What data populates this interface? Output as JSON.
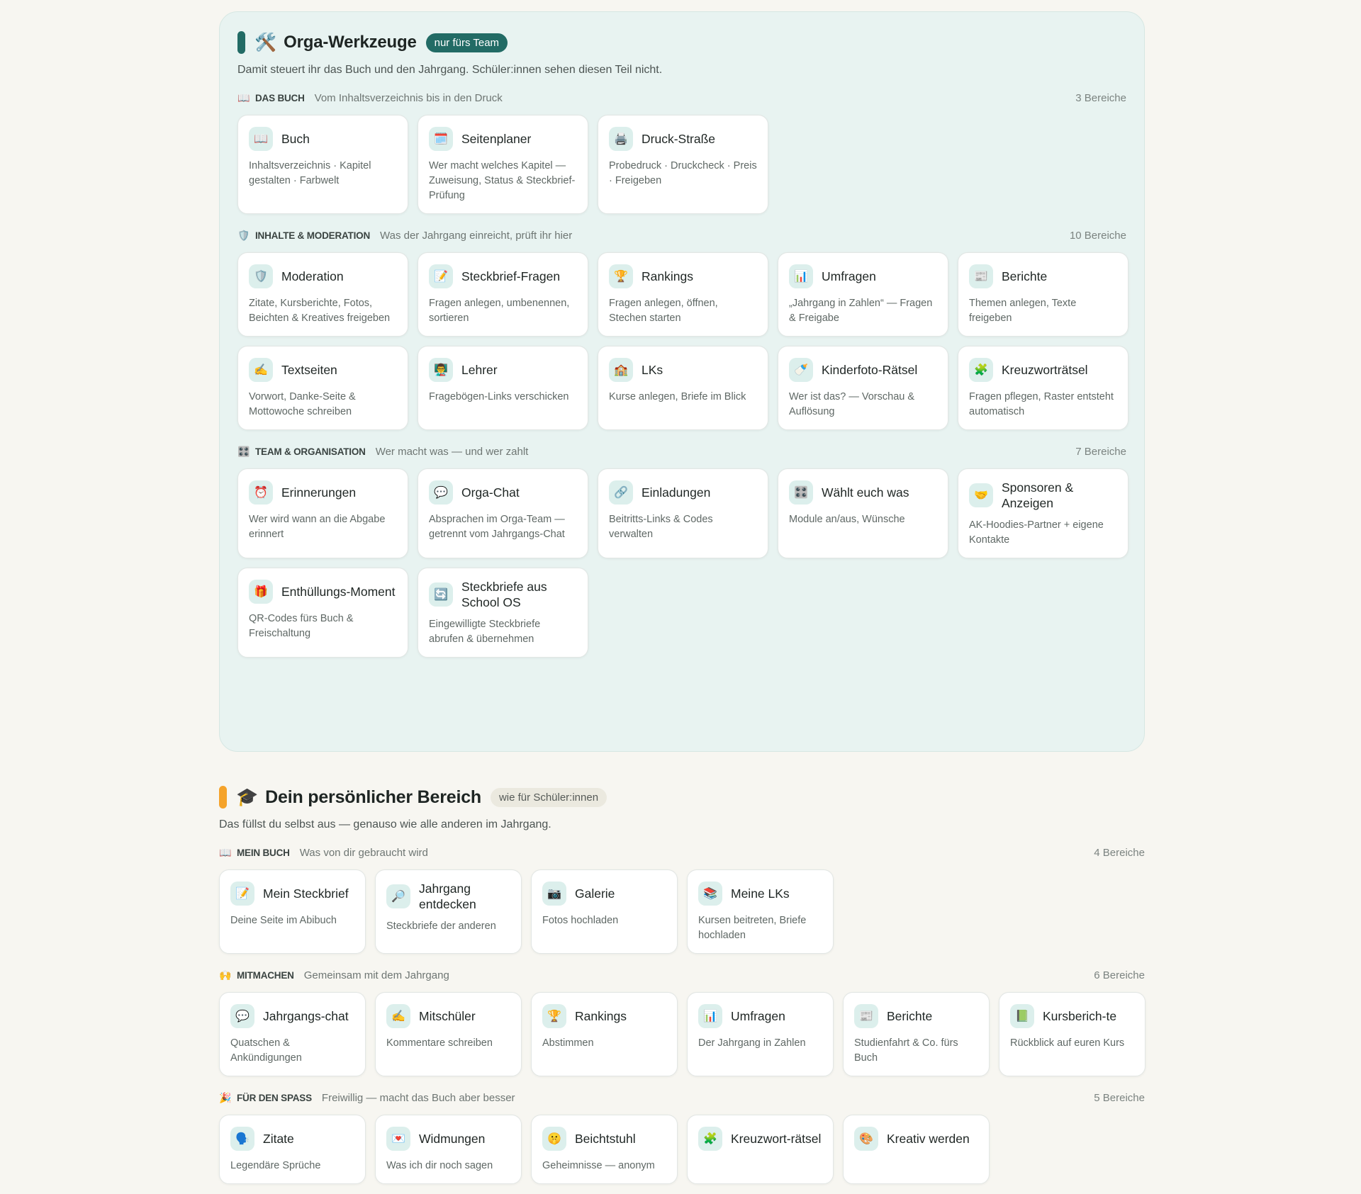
{
  "orga": {
    "accent_color": "#226b65",
    "icon": "🛠️",
    "title": "Orga-Werkzeuge",
    "badge": "nur fürs Team",
    "desc": "Damit steuert ihr das Buch und den Jahrgang. Schüler:innen sehen diesen Teil nicht.",
    "sections": [
      {
        "icon": "📖",
        "title": "DAS BUCH",
        "sub": "Vom Inhaltsverzeichnis bis in den Druck",
        "count": "3 Bereiche",
        "cards": [
          {
            "icon": "📖",
            "title": "Buch",
            "desc": "Inhaltsverzeichnis · Kapitel gestalten · Farbwelt"
          },
          {
            "icon": "🗓️",
            "title": "Seitenplaner",
            "desc": "Wer macht welches Kapitel — Zuweisung, Status & Steckbrief-Prüfung"
          },
          {
            "icon": "🖨️",
            "title": "Druck-Straße",
            "desc": "Probedruck · Druckcheck · Preis · Freigeben"
          }
        ]
      },
      {
        "icon": "🛡️",
        "title": "INHALTE & MODERATION",
        "sub": "Was der Jahrgang einreicht, prüft ihr hier",
        "count": "10 Bereiche",
        "cards": [
          {
            "icon": "🛡️",
            "title": "Moderation",
            "desc": "Zitate, Kursberichte, Fotos, Beichten & Kreatives freigeben"
          },
          {
            "icon": "📝",
            "title": "Steckbrief-Fragen",
            "desc": "Fragen anlegen, umbenennen, sortieren"
          },
          {
            "icon": "🏆",
            "title": "Rankings",
            "desc": "Fragen anlegen, öffnen, Stechen starten"
          },
          {
            "icon": "📊",
            "title": "Umfragen",
            "desc": "„Jahrgang in Zahlen“ — Fragen & Freigabe"
          },
          {
            "icon": "📰",
            "title": "Berichte",
            "desc": "Themen anlegen, Texte freigeben"
          },
          {
            "icon": "✍️",
            "title": "Textseiten",
            "desc": "Vorwort, Danke-Seite & Mottowoche schreiben"
          },
          {
            "icon": "👨‍🏫",
            "title": "Lehrer",
            "desc": "Fragebögen-Links verschicken"
          },
          {
            "icon": "🏫",
            "title": "LKs",
            "desc": "Kurse anlegen, Briefe im Blick"
          },
          {
            "icon": "🍼",
            "title": "Kinderfoto-Rätsel",
            "desc": "Wer ist das? — Vorschau & Auflösung"
          },
          {
            "icon": "🧩",
            "title": "Kreuzworträtsel",
            "desc": "Fragen pflegen, Raster entsteht automatisch"
          }
        ]
      },
      {
        "icon": "🎛️",
        "title": "TEAM & ORGANISATION",
        "sub": "Wer macht was — und wer zahlt",
        "count": "7 Bereiche",
        "cards": [
          {
            "icon": "⏰",
            "title": "Erinnerungen",
            "desc": "Wer wird wann an die Abgabe erinnert"
          },
          {
            "icon": "💬",
            "title": "Orga-Chat",
            "desc": "Absprachen im Orga-Team — getrennt vom Jahrgangs-Chat"
          },
          {
            "icon": "🔗",
            "title": "Einladungen",
            "desc": "Beitritts-Links & Codes verwalten"
          },
          {
            "icon": "🎛️",
            "title": "Wählt euch was",
            "desc": "Module an/aus, Wünsche"
          },
          {
            "icon": "🤝",
            "title": "Sponsoren & Anzeigen",
            "desc": "AK-Hoodies-Partner + eigene Kontakte"
          },
          {
            "icon": "🎁",
            "title": "Enthüllungs-Moment",
            "desc": "QR-Codes fürs Buch & Freischaltung"
          },
          {
            "icon": "🔄",
            "title": "Steckbriefe aus School OS",
            "desc": "Eingewilligte Steckbriefe abrufen & übernehmen"
          }
        ]
      }
    ]
  },
  "personal": {
    "accent_color": "#f5a32a",
    "icon": "🎓",
    "title": "Dein persönlicher Bereich",
    "badge": "wie für Schüler:innen",
    "desc": "Das füllst du selbst aus — genauso wie alle anderen im Jahrgang.",
    "sections": [
      {
        "icon": "📖",
        "title": "MEIN BUCH",
        "sub": "Was von dir gebraucht wird",
        "count": "4 Bereiche",
        "cards": [
          {
            "icon": "📝",
            "title": "Mein Steckbrief",
            "desc": "Deine Seite im Abibuch"
          },
          {
            "icon": "🔎",
            "title": "Jahrgang entdecken",
            "desc": "Steckbriefe der anderen"
          },
          {
            "icon": "📷",
            "title": "Galerie",
            "desc": "Fotos hochladen"
          },
          {
            "icon": "📚",
            "title": "Meine LKs",
            "desc": "Kursen beitreten, Briefe hochladen"
          }
        ]
      },
      {
        "icon": "🙌",
        "title": "MITMACHEN",
        "sub": "Gemeinsam mit dem Jahrgang",
        "count": "6 Bereiche",
        "cards": [
          {
            "icon": "💬",
            "title": "Jahrgangs-chat",
            "desc": "Quatschen & Ankündigungen"
          },
          {
            "icon": "✍️",
            "title": "Mitschüler",
            "desc": "Kommentare schreiben"
          },
          {
            "icon": "🏆",
            "title": "Rankings",
            "desc": "Abstimmen"
          },
          {
            "icon": "📊",
            "title": "Umfragen",
            "desc": "Der Jahrgang in Zahlen"
          },
          {
            "icon": "📰",
            "title": "Berichte",
            "desc": "Studienfahrt & Co. fürs Buch"
          },
          {
            "icon": "📗",
            "title": "Kursberich-te",
            "desc": "Rückblick auf euren Kurs"
          }
        ]
      },
      {
        "icon": "🎉",
        "title": "FÜR DEN SPASS",
        "sub": "Freiwillig — macht das Buch aber besser",
        "count": "5 Bereiche",
        "cards": [
          {
            "icon": "🗣️",
            "title": "Zitate",
            "desc": "Legendäre Sprüche"
          },
          {
            "icon": "💌",
            "title": "Widmungen",
            "desc": "Was ich dir noch sagen"
          },
          {
            "icon": "🤫",
            "title": "Beichtstuhl",
            "desc": "Geheimnisse — anonym"
          },
          {
            "icon": "🧩",
            "title": "Kreuzwort-rätsel",
            "desc": ""
          },
          {
            "icon": "🎨",
            "title": "Kreativ werden",
            "desc": ""
          }
        ]
      }
    ]
  }
}
